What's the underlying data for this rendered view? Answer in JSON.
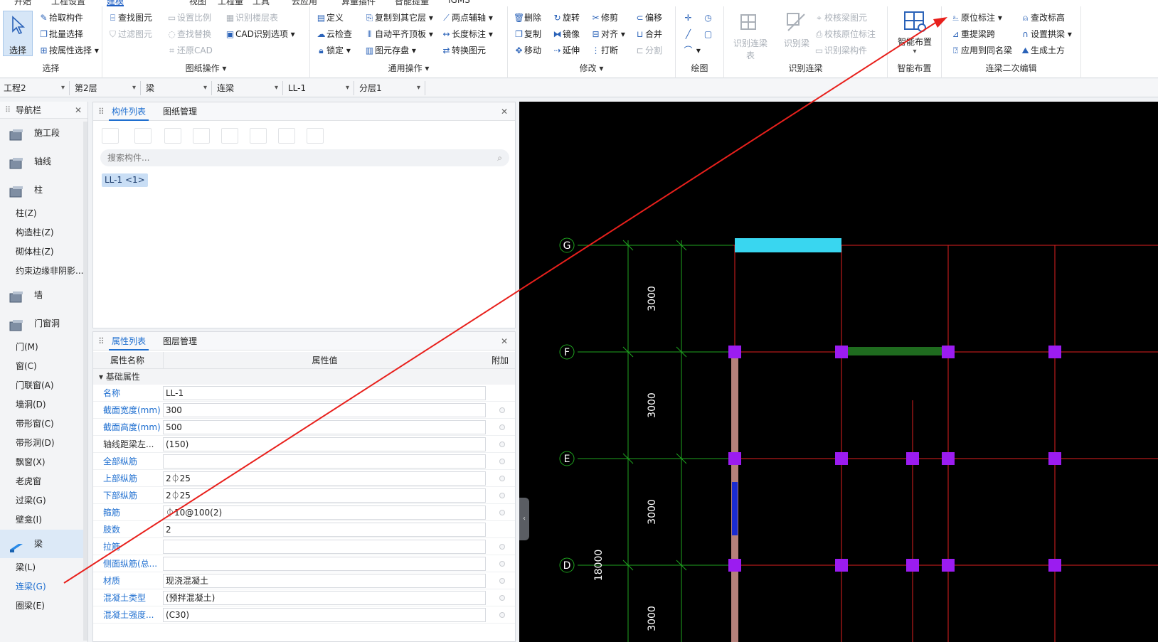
{
  "menubar": {
    "tabs": [
      "开始",
      "工程设置",
      "建模",
      "视图",
      "工程量",
      "工具",
      "云应用",
      "算量插件",
      "智能提量",
      "IGMS"
    ]
  },
  "ribbon": {
    "select_group": {
      "title": "选择",
      "select_label": "选择",
      "pick": "拾取构件",
      "batch": "批量选择",
      "by_attr": "按属性选择"
    },
    "drawing_group": {
      "title": "图纸操作",
      "find": "查找图元",
      "filter": "过滤图元",
      "set_scale": "设置比例",
      "find_replace": "查找替换",
      "restore_cad": "还原CAD",
      "identify_layers": "识别楼层表",
      "cad_options": "CAD识别选项"
    },
    "common_group": {
      "title": "通用操作",
      "define": "定义",
      "cloud_check": "云检查",
      "lock": "锁定",
      "copy_to_floor": "复制到其它层",
      "auto_flush": "自动平齐顶板",
      "element_save": "图元存盘",
      "two_point_axis": "两点辅轴",
      "length_mark": "长度标注",
      "convert_element": "转换图元"
    },
    "modify_group": {
      "title": "修改",
      "delete": "删除",
      "copy": "复制",
      "move": "移动",
      "rotate": "旋转",
      "mirror": "镜像",
      "extend": "延伸",
      "trim": "修剪",
      "align": "对齐",
      "break": "打断",
      "offset": "偏移",
      "merge": "合并",
      "split": "分割"
    },
    "draw_group": {
      "title": "绘图"
    },
    "identify_group": {
      "title": "识别连梁",
      "identify_table": "识别连梁表",
      "identify_beam": "识别梁",
      "verify_element": "校核梁图元",
      "verify_position": "校核原位标注",
      "identify_component": "识别梁构件"
    },
    "smart_group": {
      "title": "智能布置",
      "smart_place": "智能布置"
    },
    "edit_group": {
      "title": "连梁二次编辑",
      "original_mark": "原位标注",
      "re_span": "重提梁跨",
      "apply_same": "应用到同名梁",
      "check_elev": "查改标高",
      "set_arch": "设置拱梁",
      "gen_earth": "生成土方"
    }
  },
  "combos": [
    "工程2",
    "第2层",
    "梁",
    "连梁",
    "LL-1",
    "分层1"
  ],
  "nav": {
    "title": "导航栏",
    "items": [
      {
        "type": "cat",
        "label": "施工段",
        "icon": "construction-section-icon"
      },
      {
        "type": "cat",
        "label": "轴线",
        "icon": "grid-axis-icon"
      },
      {
        "type": "cat",
        "label": "柱",
        "icon": "column-icon"
      },
      {
        "type": "sub",
        "label": "柱(Z)"
      },
      {
        "type": "sub",
        "label": "构造柱(Z)"
      },
      {
        "type": "sub",
        "label": "砌体柱(Z)"
      },
      {
        "type": "sub",
        "label": "约束边缘非阴影..."
      },
      {
        "type": "cat",
        "label": "墙",
        "icon": "wall-icon"
      },
      {
        "type": "cat",
        "label": "门窗洞",
        "icon": "door-window-icon"
      },
      {
        "type": "sub",
        "label": "门(M)"
      },
      {
        "type": "sub",
        "label": "窗(C)"
      },
      {
        "type": "sub",
        "label": "门联窗(A)"
      },
      {
        "type": "sub",
        "label": "墙洞(D)"
      },
      {
        "type": "sub",
        "label": "带形窗(C)"
      },
      {
        "type": "sub",
        "label": "带形洞(D)"
      },
      {
        "type": "sub",
        "label": "飘窗(X)"
      },
      {
        "type": "sub",
        "label": "老虎窗"
      },
      {
        "type": "sub",
        "label": "过梁(G)"
      },
      {
        "type": "sub",
        "label": "壁龛(I)"
      },
      {
        "type": "cat",
        "label": "梁",
        "icon": "beam-icon",
        "selected": true
      },
      {
        "type": "sub",
        "label": "梁(L)"
      },
      {
        "type": "sub",
        "label": "连梁(G)",
        "selected": true
      },
      {
        "type": "sub",
        "label": "圈梁(E)"
      }
    ]
  },
  "component_panel": {
    "tab_list": "构件列表",
    "tab_drawing": "图纸管理",
    "search_placeholder": "搜索构件...",
    "component": "LL-1 <1>"
  },
  "property_panel": {
    "tab_props": "属性列表",
    "tab_layers": "图层管理",
    "col_name": "属性名称",
    "col_value": "属性值",
    "col_extra": "附加",
    "section": "基础属性",
    "rows": [
      {
        "name": "名称",
        "value": "LL-1",
        "blue": true,
        "extra": false
      },
      {
        "name": "截面宽度(mm)",
        "value": "300",
        "blue": true,
        "extra": true
      },
      {
        "name": "截面高度(mm)",
        "value": "500",
        "blue": true,
        "extra": true
      },
      {
        "name": "轴线距梁左...",
        "value": "(150)",
        "blue": false,
        "extra": true
      },
      {
        "name": "全部纵筋",
        "value": "",
        "blue": true,
        "extra": true
      },
      {
        "name": "上部纵筋",
        "value": "2⏀25",
        "blue": true,
        "extra": true
      },
      {
        "name": "下部纵筋",
        "value": "2⏀25",
        "blue": true,
        "extra": true
      },
      {
        "name": "箍筋",
        "value": "⏀10@100(2)",
        "blue": true,
        "extra": true
      },
      {
        "name": "肢数",
        "value": "2",
        "blue": true,
        "extra": false
      },
      {
        "name": "拉筋",
        "value": "",
        "blue": true,
        "extra": true
      },
      {
        "name": "侧面纵筋(总...",
        "value": "",
        "blue": true,
        "extra": true
      },
      {
        "name": "材质",
        "value": "现浇混凝土",
        "blue": true,
        "extra": true
      },
      {
        "name": "混凝土类型",
        "value": "(预拌混凝土)",
        "blue": true,
        "extra": true
      },
      {
        "name": "混凝土强度...",
        "value": "(C30)",
        "blue": true,
        "extra": true
      }
    ]
  },
  "canvas": {
    "axes": [
      "G",
      "F",
      "E",
      "D"
    ],
    "dims": [
      "3000",
      "3000",
      "3000",
      "18000",
      "3000"
    ],
    "colors": {
      "background": "#000000",
      "axis_green": "#1fa51f",
      "grid_red": "#e02020",
      "column": "#9b1cf0",
      "beam_cyan": "#39d6f0",
      "beam_green": "#1f6b1f",
      "arrow": "#e8201c"
    }
  }
}
